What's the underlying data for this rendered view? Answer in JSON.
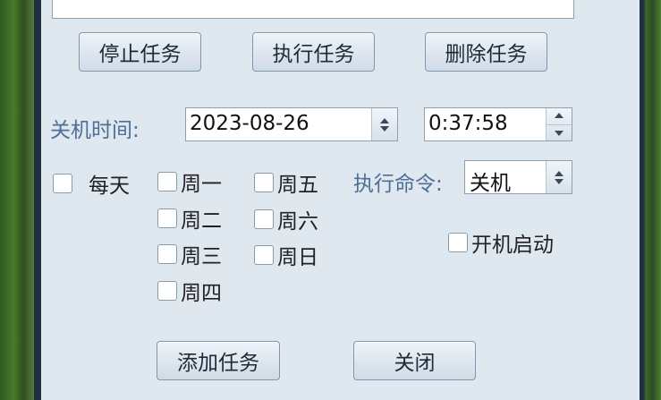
{
  "buttons": {
    "stop_task": "停止任务",
    "run_task": "执行任务",
    "delete_task": "删除任务",
    "add_task": "添加任务",
    "close": "关闭"
  },
  "shutdown_time": {
    "label": "关机时间:",
    "date": "2023-08-26",
    "time": "0:37:58"
  },
  "command": {
    "label": "执行命令:",
    "selected": "关机"
  },
  "checkboxes": {
    "daily": "每天",
    "mon": "周一",
    "tue": "周二",
    "wed": "周三",
    "thu": "周四",
    "fri": "周五",
    "sat": "周六",
    "sun": "周日",
    "startup": "开机启动"
  },
  "icons": {
    "spin_up": "chevron-up-icon",
    "spin_down": "chevron-down-icon"
  }
}
